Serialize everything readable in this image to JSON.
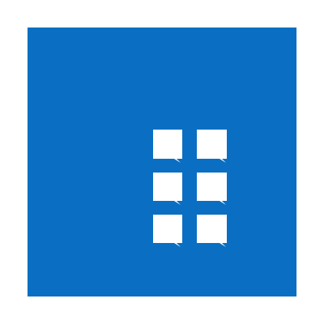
{
  "app_tile": {
    "icon": "grid-six-squares-icon",
    "background_color": "#0a6fc2",
    "icon_color": "#ffffff"
  }
}
